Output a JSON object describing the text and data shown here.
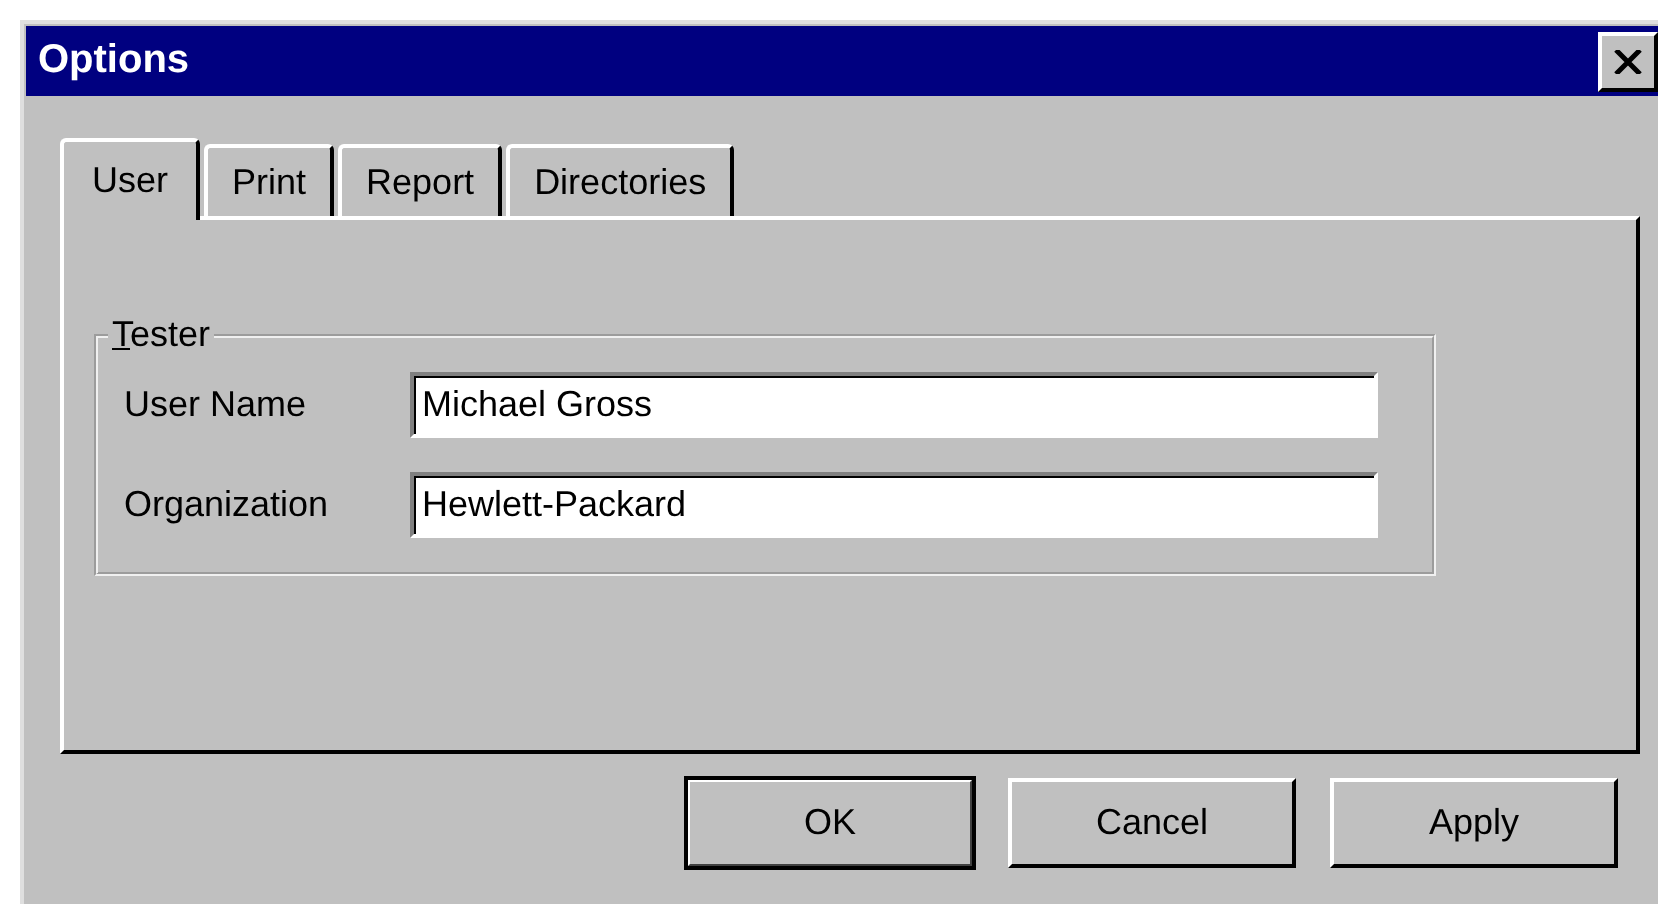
{
  "window": {
    "title": "Options"
  },
  "tabs": [
    {
      "label": "User",
      "selected": true
    },
    {
      "label": "Print",
      "selected": false
    },
    {
      "label": "Report",
      "selected": false
    },
    {
      "label": "Directories",
      "selected": false
    }
  ],
  "group": {
    "legend": "Tester",
    "fields": [
      {
        "label": "User Name",
        "value": "Michael Gross"
      },
      {
        "label": "Organization",
        "value": "Hewlett-Packard"
      }
    ]
  },
  "buttons": [
    {
      "label": "OK",
      "default": true
    },
    {
      "label": "Cancel",
      "default": false
    },
    {
      "label": "Apply",
      "default": false
    }
  ]
}
